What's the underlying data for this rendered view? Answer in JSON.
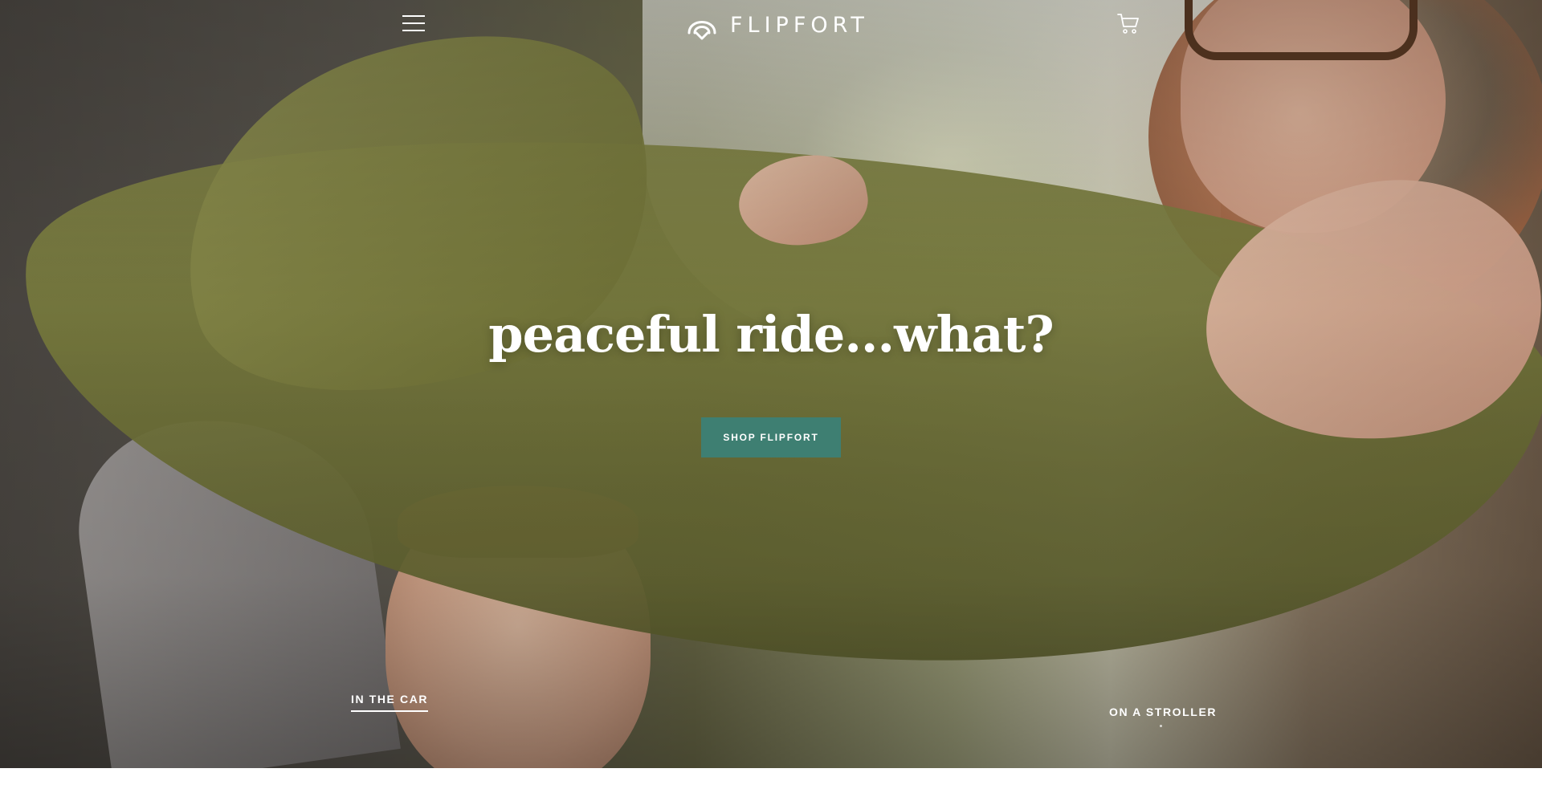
{
  "header": {
    "menu_icon": "hamburger-menu-icon",
    "logo_icon": "flipfort-logo-icon",
    "logo_text": "FLIPFORT",
    "cart_icon": "shopping-cart-icon"
  },
  "hero": {
    "headline": "peaceful ride...what?",
    "cta_label": "SHOP FLIPFORT",
    "cta_color": "#3e7f72",
    "slides": [
      {
        "label": "IN THE CAR",
        "active": true
      },
      {
        "label": "ON A STROLLER",
        "active": false
      }
    ]
  },
  "colors": {
    "text_on_image": "#ffffff",
    "accent": "#3e7f72"
  }
}
